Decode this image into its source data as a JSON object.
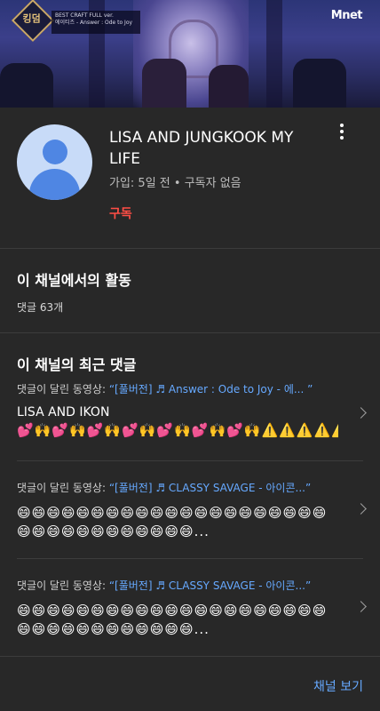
{
  "banner": {
    "badge_text": "킹덤",
    "caption_line1": "BEST CRAFT FULL ver.",
    "caption_line2": "에이티즈 - Answer : Ode to Joy",
    "network": "Mnet"
  },
  "channel": {
    "name": "LISA AND JUNGKOOK MY LIFE",
    "meta": "가입: 5일 전 • 구독자 없음",
    "subscribe_label": "구독",
    "more_icon": "vertical-dots-icon"
  },
  "activity": {
    "title": "이 채널에서의 활동",
    "comment_count": "댓글 63개"
  },
  "recent": {
    "title": "이 채널의 최근 댓글",
    "comments": [
      {
        "label": "댓글이 달린 동영상: ",
        "video": "“[풀버전] ♬ Answer : Ode to Joy - 에... ”",
        "text": "LISA AND IKON",
        "emoji": "💕🙌💕🙌💕🙌💕🙌💕🙌💕🙌💕🙌⚠️⚠️⚠️⚠️⚠️..."
      },
      {
        "label": "댓글이 달린 동영상: ",
        "video": "“[풀버전] ♬ CLASSY SAVAGE - 아이콘...”",
        "text": "",
        "emoji": "😄😄😄😄😄😄😄😄😄😄😄😄😄😄😄😄😄😄😄😄😄😄😄😄😄😄😄😄😄😄😄😄😄..."
      },
      {
        "label": "댓글이 달린 동영상: ",
        "video": "“[풀버전] ♬ CLASSY SAVAGE - 아이콘...”",
        "text": "",
        "emoji": "😄😄😄😄😄😄😄😄😄😄😄😄😄😄😄😄😄😄😄😄😄😄😄😄😄😄😄😄😄😄😄😄😄..."
      }
    ]
  },
  "footer": {
    "view_channel": "채널 보기"
  },
  "colors": {
    "background": "#282828",
    "subscribe": "#ff4e45",
    "link": "#66a9ff"
  }
}
